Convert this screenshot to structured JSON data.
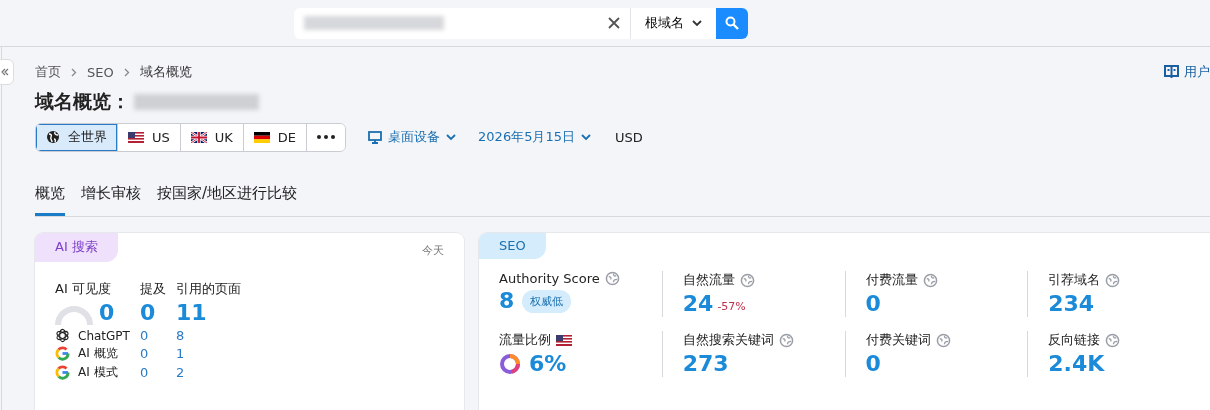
{
  "search": {
    "scope": "根域名"
  },
  "guide_link": "用户",
  "breadcrumb": [
    "首页",
    "SEO",
    "域名概览"
  ],
  "title": "域名概览：",
  "regions": [
    {
      "kind": "globe",
      "label": "全世界",
      "selected": true
    },
    {
      "kind": "us",
      "label": "US",
      "selected": false
    },
    {
      "kind": "uk",
      "label": "UK",
      "selected": false
    },
    {
      "kind": "de",
      "label": "DE",
      "selected": false
    }
  ],
  "device": "桌面设备",
  "date": "2026年5月15日",
  "currency": "USD",
  "tabs": [
    {
      "label": "概览",
      "selected": true
    },
    {
      "label": "增长审核",
      "selected": false
    },
    {
      "label": "按国家/地区进行比较",
      "selected": false
    }
  ],
  "ai_card": {
    "badge": "AI 搜索",
    "period": "今天",
    "columns": [
      "AI 可见度",
      "提及",
      "引用的页面"
    ],
    "totals": [
      "0",
      "0",
      "11"
    ],
    "rows": [
      {
        "kind": "chatgpt",
        "name": "ChatGPT",
        "mentions": "0",
        "pages": "8"
      },
      {
        "kind": "google",
        "name": "AI 概览",
        "mentions": "0",
        "pages": "1"
      },
      {
        "kind": "google",
        "name": "AI 模式",
        "mentions": "0",
        "pages": "2"
      }
    ]
  },
  "seo_card": {
    "badge": "SEO",
    "metrics": [
      {
        "kind": "info",
        "label": "Authority Score",
        "value": "8",
        "tag": "权威低"
      },
      {
        "kind": "info",
        "label": "自然流量",
        "value": "24",
        "change": "-57%"
      },
      {
        "kind": "info",
        "label": "付费流量",
        "value": "0"
      },
      {
        "kind": "info",
        "label": "引荐域名",
        "value": "234"
      },
      {
        "kind": "share",
        "label": "流量比例",
        "value": "6%"
      },
      {
        "kind": "info",
        "label": "自然搜索关键词",
        "value": "273"
      },
      {
        "kind": "info",
        "label": "付费关键词",
        "value": "0"
      },
      {
        "kind": "info",
        "label": "反向链接",
        "value": "2.4K"
      }
    ]
  }
}
